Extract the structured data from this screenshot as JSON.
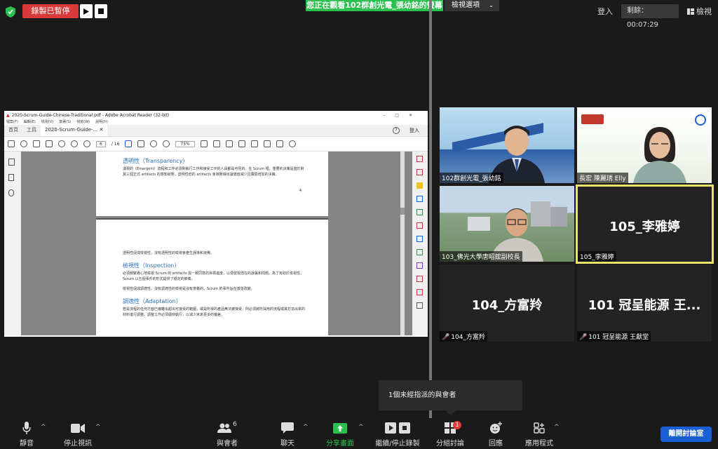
{
  "topbar": {
    "recording_status": "錄製已暫停",
    "banner": "您正在觀看102群創光電_張幼銘的螢幕",
    "view_options": "檢視選項",
    "login": "登入",
    "timer_label": "剩餘：",
    "timer_value": "00:07:29",
    "view": "檢視"
  },
  "acrobat": {
    "title": "2020-Scrum-Guide-Chinese-Traditional.pdf - Adobe Acrobat Reader (32-bit)",
    "menu": [
      "檔案(F)",
      "編輯(E)",
      "檢視(V)",
      "簽署(S)",
      "視窗(W)",
      "說明(H)"
    ],
    "tabs": [
      "首頁",
      "工具",
      "2020-Scrum-Guide-..."
    ],
    "login": "登入",
    "page_current": "6",
    "page_total": "/ 16",
    "zoom": "75%",
    "page1": {
      "heading": "透明性（Transparency）",
      "body": "湧現的（Emergent）流程和工作必須對執行工作和接受工作的人員都是可見的。在 Scrum 裡，重要的決策是基於對其三個正式 artifacts 的感知狀態，透明性低的 artifacts 會導致做出讓價值減少且風險增加的決策。",
      "page_number": "4"
    },
    "page2": {
      "line1": "透明性促成檢視性，沒有透明性的檢視會產生誤導和浪費。",
      "heading1": "檢視性（Inspection）",
      "body1": "必須頻繁專心地檢視 Scrum 的 artifacts 與一致同意的目標進度，以便發現潛在的誤差和問題。為了有助於檢視性，Scrum 以五個事件的形式提供了穩定的節奏。",
      "line2": "檢視性促成調適性。沒有調適性的檢視是沒有意義的。Scrum 的事件旨在激發改變。",
      "heading2": "調適性（Adaptation）",
      "body2": "若是流程的任何方面已偏離出超出可接受的範圍，或是所得的產品無法被接受，則必須將所採用的流程或其打造出來的材料進行調整。調整工作必須儘快執行，以減少未來更多的偏差。"
    }
  },
  "participants": [
    {
      "name": "102群創光電_張幼銘",
      "kind": "video",
      "muted": false
    },
    {
      "name": "長宏 陳麗琇 Elly",
      "kind": "video",
      "muted": false
    },
    {
      "name": "103_佛光大學唐昭鋐副校長",
      "kind": "video",
      "muted": false
    },
    {
      "name": "105_李雅婷",
      "big": "105_李雅婷",
      "kind": "name",
      "muted": false,
      "active": true
    },
    {
      "name": "104_方富羚",
      "big": "104_方富羚",
      "kind": "name",
      "muted": true
    },
    {
      "name": "101 冠呈能源 王獻堂",
      "big": "101 冠呈能源 王...",
      "kind": "name",
      "muted": true
    }
  ],
  "popup": "1個未經指派的與會者",
  "toolbar": {
    "mute": "靜音",
    "stop_video": "停止視訊",
    "participants": "與會者",
    "participants_count": "6",
    "chat": "聊天",
    "share": "分享畫面",
    "record": "繼續/停止錄製",
    "breakout": "分組討論",
    "breakout_badge": "1",
    "reactions": "回應",
    "apps": "應用程式",
    "leave": "離開討論室"
  },
  "colors": {
    "recording_red": "#d93a3a",
    "banner_green": "#2ac04d",
    "leave_blue": "#1a5fd6",
    "active_speaker": "#e8e36a"
  }
}
